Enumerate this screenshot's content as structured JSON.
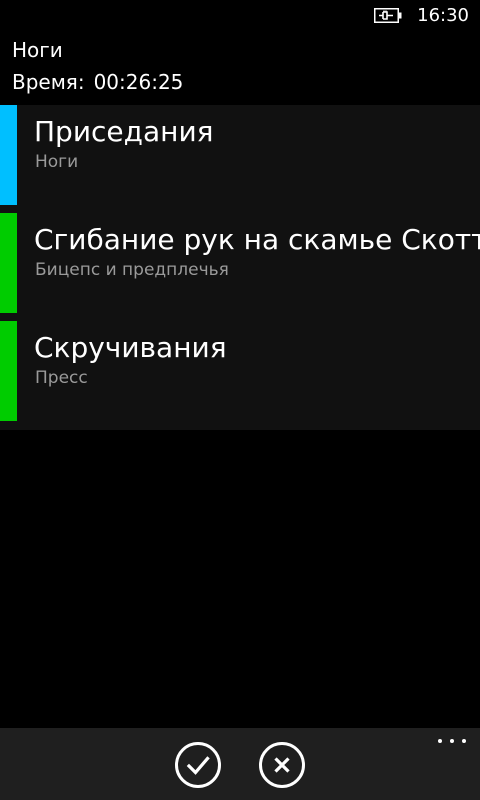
{
  "status_bar": {
    "time": "16:30",
    "battery_icon": "battery-charging-icon"
  },
  "header": {
    "title": "Ноги",
    "time_label": "Время:",
    "time_value": "00:26:25"
  },
  "exercises": [
    {
      "name": "Приседания",
      "group": "Ноги",
      "color": "#00bfff"
    },
    {
      "name": "Сгибание рук на скамье Скотта",
      "group": "Бицепс и предплечья",
      "color": "#00cc00"
    },
    {
      "name": "Скручивания",
      "group": "Пресс",
      "color": "#00cc00"
    }
  ],
  "app_bar": {
    "confirm_icon": "check-icon",
    "cancel_icon": "close-icon",
    "more_icon": "more-dots-icon"
  },
  "colors": {
    "background": "#000000",
    "list_background": "#111111",
    "app_bar_background": "#1f1f1f",
    "subtext": "#9a9a9a"
  }
}
